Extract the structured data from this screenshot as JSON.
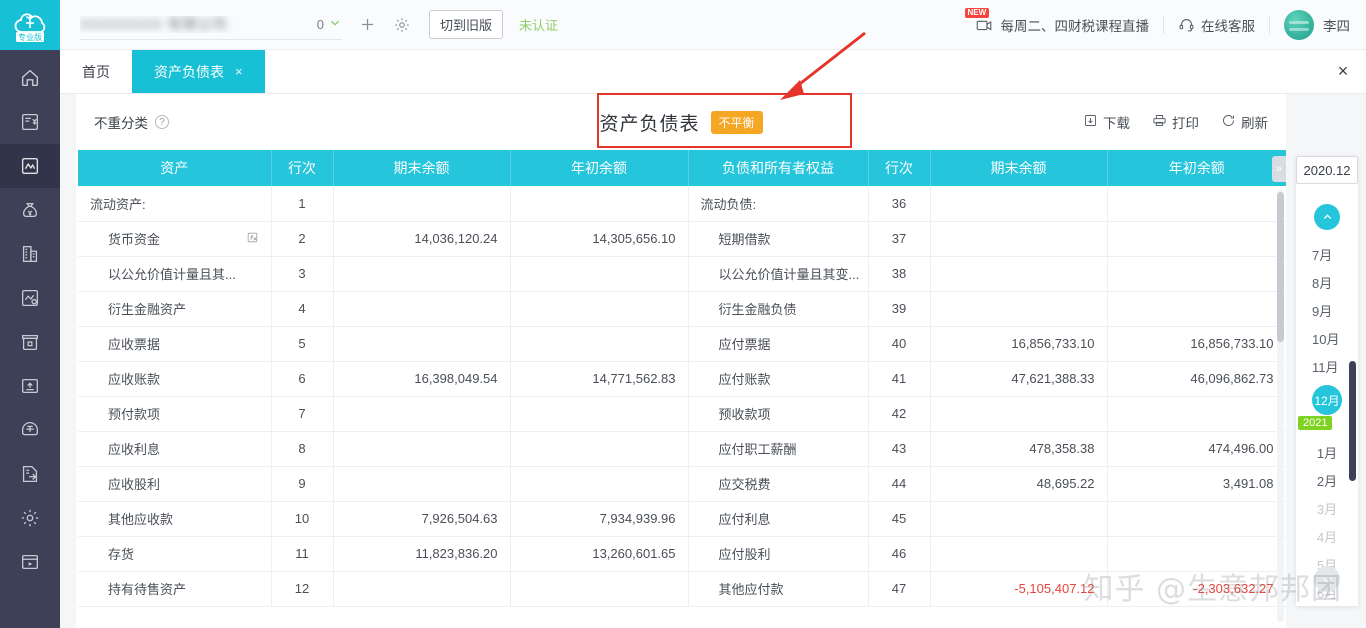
{
  "brand": {
    "logo_text": "专业版",
    "accent": "#17c0d4"
  },
  "topbar": {
    "company_name_redacted": "XXXXXXXX 有限公司",
    "company_name_tail": "0",
    "dropdown_icon": "chevron-down-icon",
    "add_label": "+",
    "settings_icon": "gear-icon",
    "switch_version_label": "切到旧版",
    "unverified_label": "未认证",
    "live_course_label": "每周二、四财税课程直播",
    "live_new_badge": "NEW",
    "support_label": "在线客服",
    "user_name": "李四"
  },
  "tabs": [
    {
      "label": "首页",
      "active": false,
      "closable": false
    },
    {
      "label": "资产负债表",
      "active": true,
      "closable": true,
      "close": "×"
    }
  ],
  "tabstrip": {
    "close_all": "×"
  },
  "card_head": {
    "classify_label": "不重分类",
    "help_icon": "question-circle-icon",
    "report_title": "资产负债表",
    "imbalance_badge": "不平衡",
    "actions": [
      {
        "label": "下载",
        "icon": "download-icon"
      },
      {
        "label": "打印",
        "icon": "printer-icon"
      },
      {
        "label": "刷新",
        "icon": "refresh-icon"
      }
    ]
  },
  "table": {
    "headers": [
      "资产",
      "行次",
      "期末余额",
      "年初余额",
      "负债和所有者权益",
      "行次",
      "期末余额",
      "年初余额"
    ],
    "rows": [
      {
        "asset": "流动资产:",
        "a_line": "1",
        "a_end": "",
        "a_begin": "",
        "liab": "流动负债:",
        "l_line": "36",
        "l_end": "",
        "l_begin": "",
        "asset_indent": false,
        "liab_indent": false,
        "fx": false,
        "neg": false
      },
      {
        "asset": "货币资金",
        "a_line": "2",
        "a_end": "14,036,120.24",
        "a_begin": "14,305,656.10",
        "liab": "短期借款",
        "l_line": "37",
        "l_end": "",
        "l_begin": "",
        "asset_indent": true,
        "liab_indent": true,
        "fx": true,
        "neg": false
      },
      {
        "asset": "以公允价值计量且其...",
        "a_line": "3",
        "a_end": "",
        "a_begin": "",
        "liab": "以公允价值计量且其变...",
        "l_line": "38",
        "l_end": "",
        "l_begin": "",
        "asset_indent": true,
        "liab_indent": true,
        "fx": false,
        "neg": false
      },
      {
        "asset": "衍生金融资产",
        "a_line": "4",
        "a_end": "",
        "a_begin": "",
        "liab": "衍生金融负债",
        "l_line": "39",
        "l_end": "",
        "l_begin": "",
        "asset_indent": true,
        "liab_indent": true,
        "fx": false,
        "neg": false
      },
      {
        "asset": "应收票据",
        "a_line": "5",
        "a_end": "",
        "a_begin": "",
        "liab": "应付票据",
        "l_line": "40",
        "l_end": "16,856,733.10",
        "l_begin": "16,856,733.10",
        "asset_indent": true,
        "liab_indent": true,
        "fx": false,
        "neg": false
      },
      {
        "asset": "应收账款",
        "a_line": "6",
        "a_end": "16,398,049.54",
        "a_begin": "14,771,562.83",
        "liab": "应付账款",
        "l_line": "41",
        "l_end": "47,621,388.33",
        "l_begin": "46,096,862.73",
        "asset_indent": true,
        "liab_indent": true,
        "fx": false,
        "neg": false
      },
      {
        "asset": "预付款项",
        "a_line": "7",
        "a_end": "",
        "a_begin": "",
        "liab": "预收款项",
        "l_line": "42",
        "l_end": "",
        "l_begin": "",
        "asset_indent": true,
        "liab_indent": true,
        "fx": false,
        "neg": false
      },
      {
        "asset": "应收利息",
        "a_line": "8",
        "a_end": "",
        "a_begin": "",
        "liab": "应付职工薪酬",
        "l_line": "43",
        "l_end": "478,358.38",
        "l_begin": "474,496.00",
        "asset_indent": true,
        "liab_indent": true,
        "fx": false,
        "neg": false
      },
      {
        "asset": "应收股利",
        "a_line": "9",
        "a_end": "",
        "a_begin": "",
        "liab": "应交税费",
        "l_line": "44",
        "l_end": "48,695.22",
        "l_begin": "3,491.08",
        "asset_indent": true,
        "liab_indent": true,
        "fx": false,
        "neg": false
      },
      {
        "asset": "其他应收款",
        "a_line": "10",
        "a_end": "7,926,504.63",
        "a_begin": "7,934,939.96",
        "liab": "应付利息",
        "l_line": "45",
        "l_end": "",
        "l_begin": "",
        "asset_indent": true,
        "liab_indent": true,
        "fx": false,
        "neg": false
      },
      {
        "asset": "存货",
        "a_line": "11",
        "a_end": "11,823,836.20",
        "a_begin": "13,260,601.65",
        "liab": "应付股利",
        "l_line": "46",
        "l_end": "",
        "l_begin": "",
        "asset_indent": true,
        "liab_indent": true,
        "fx": false,
        "neg": false
      },
      {
        "asset": "持有待售资产",
        "a_line": "12",
        "a_end": "",
        "a_begin": "",
        "liab": "其他应付款",
        "l_line": "47",
        "l_end": "-5,105,407.12",
        "l_begin": "-2,303,632.27",
        "asset_indent": true,
        "liab_indent": true,
        "fx": false,
        "neg": true
      }
    ]
  },
  "period_panel": {
    "current_period": "2020.12",
    "scroll_up_icon": "chevron-up-icon",
    "scroll_down_icon": "chevron-down-icon",
    "year_badge": "2021",
    "months_before": [
      {
        "label": "7月",
        "state": "normal"
      },
      {
        "label": "8月",
        "state": "normal"
      },
      {
        "label": "9月",
        "state": "normal"
      },
      {
        "label": "10月",
        "state": "normal"
      },
      {
        "label": "11月",
        "state": "normal"
      },
      {
        "label": "12月",
        "state": "selected"
      }
    ],
    "months_after": [
      {
        "label": "1月",
        "state": "normal"
      },
      {
        "label": "2月",
        "state": "normal"
      },
      {
        "label": "3月",
        "state": "dim"
      },
      {
        "label": "4月",
        "state": "dim"
      },
      {
        "label": "5月",
        "state": "dim"
      },
      {
        "label": "6月",
        "state": "dim"
      }
    ]
  },
  "sidebar": {
    "items": [
      {
        "name": "home",
        "icon": "home-icon",
        "active": false
      },
      {
        "name": "invoice",
        "icon": "invoice-yuan-icon",
        "active": false
      },
      {
        "name": "reports",
        "icon": "chart-line-icon",
        "active": true
      },
      {
        "name": "funds",
        "icon": "money-bag-icon",
        "active": false
      },
      {
        "name": "assets",
        "icon": "building-icon",
        "active": false
      },
      {
        "name": "analysis",
        "icon": "report-clock-icon",
        "active": false
      },
      {
        "name": "cashier",
        "icon": "cashbox-icon",
        "active": false
      },
      {
        "name": "archive",
        "icon": "archive-box-icon",
        "active": false
      },
      {
        "name": "tax",
        "icon": "stamp-icon",
        "active": false
      },
      {
        "name": "export",
        "icon": "export-page-icon",
        "active": false
      },
      {
        "name": "settings",
        "icon": "gear-icon",
        "active": false
      },
      {
        "name": "video",
        "icon": "video-play-icon",
        "active": false
      }
    ]
  },
  "watermark": {
    "text": "知乎 @生意邦邦团"
  },
  "annotation": {
    "type": "red-rectangle-with-arrow",
    "color": "#e5352b"
  }
}
